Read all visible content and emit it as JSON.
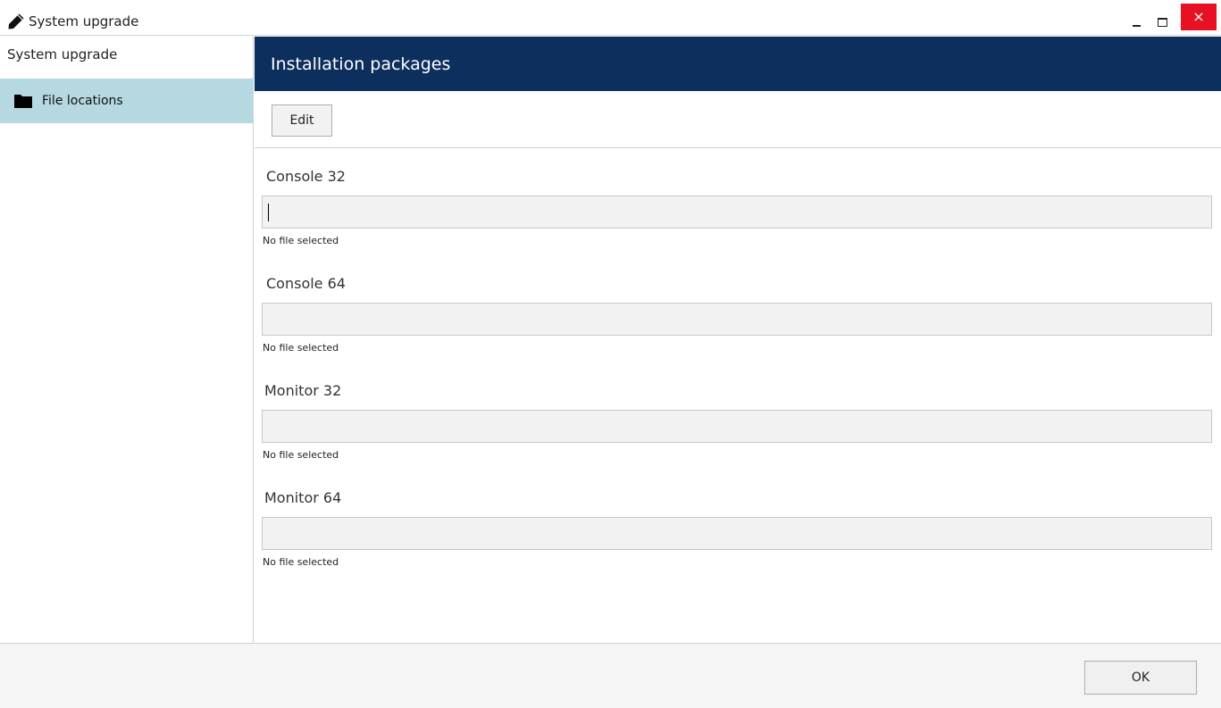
{
  "window": {
    "title": "System upgrade",
    "close_glyph": "×",
    "close_color": "#e81123"
  },
  "sidebar": {
    "title": "System upgrade",
    "items": [
      {
        "label": "File locations",
        "icon": "folder-icon",
        "selected": true
      }
    ],
    "selected_color": "#b6d8e0"
  },
  "panel": {
    "title": "Installation packages",
    "header_color": "#0d2f5e",
    "edit_label": "Edit"
  },
  "fields": [
    {
      "label": "Console 32",
      "value": "",
      "status": "No file selected"
    },
    {
      "label": "Console 64",
      "value": "",
      "status": "No file selected"
    },
    {
      "label": "Monitor 32",
      "value": "",
      "status": "No file selected"
    },
    {
      "label": "Monitor 64",
      "value": "",
      "status": "No file selected"
    }
  ],
  "footer": {
    "ok_label": "OK"
  }
}
